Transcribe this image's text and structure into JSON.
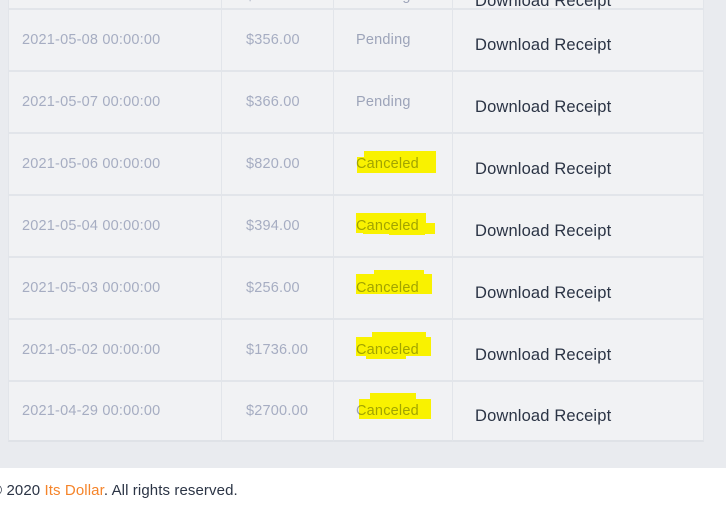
{
  "colors": {
    "page_background": "#e9ebef",
    "row_background": "#f1f2f4",
    "row_border": "#e2e5ea",
    "muted_text": "#a6adc2",
    "action_text": "#2b3445",
    "highlight_yellow": "#f9f200",
    "brand_orange": "#f5842a"
  },
  "table": {
    "columns": [
      {
        "key": "date",
        "name": "date-column"
      },
      {
        "key": "amount",
        "name": "amount-column"
      },
      {
        "key": "status",
        "name": "status-column"
      },
      {
        "key": "action",
        "name": "action-column"
      }
    ],
    "rows": [
      {
        "date": "2021-05-08 00:00:00",
        "amount": "$356.00",
        "status": "Pending",
        "highlighted": false,
        "action": "Download Receipt"
      },
      {
        "date": "2021-05-07 00:00:00",
        "amount": "$366.00",
        "status": "Pending",
        "highlighted": false,
        "action": "Download Receipt"
      },
      {
        "date": "2021-05-06 00:00:00",
        "amount": "$820.00",
        "status": "Canceled",
        "highlighted": true,
        "action": "Download Receipt"
      },
      {
        "date": "2021-05-04 00:00:00",
        "amount": "$394.00",
        "status": "Canceled",
        "highlighted": true,
        "action": "Download Receipt"
      },
      {
        "date": "2021-05-03 00:00:00",
        "amount": "$256.00",
        "status": "Canceled",
        "highlighted": true,
        "action": "Download Receipt"
      },
      {
        "date": "2021-05-02 00:00:00",
        "amount": "$1736.00",
        "status": "Canceled",
        "highlighted": true,
        "action": "Download Receipt"
      },
      {
        "date": "2021-04-29 00:00:00",
        "amount": "$2700.00",
        "status": "Canceled",
        "highlighted": true,
        "action": "Download Receipt"
      }
    ]
  },
  "footer": {
    "copyright_symbol": "©",
    "year": "2020",
    "brand": "Its Dollar",
    "rights_text": ". All rights reserved."
  }
}
